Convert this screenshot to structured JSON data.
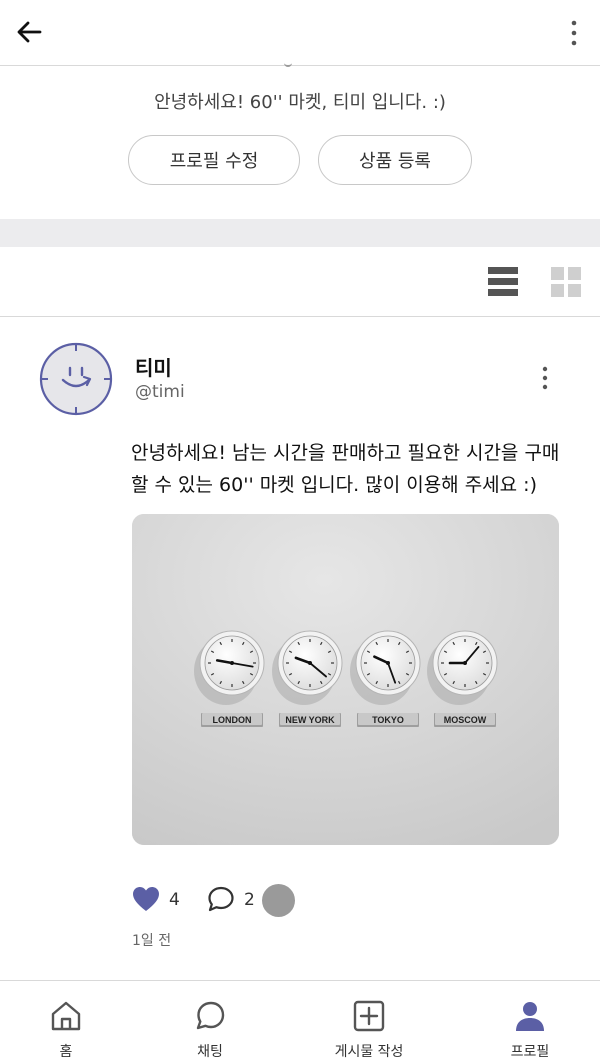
{
  "header": {
    "back_icon": "arrow-left-icon",
    "more_icon": "vertical-ellipsis-icon"
  },
  "profile": {
    "greeting": "안녕하세요! 60'' 마켓, 티미 입니다. :)",
    "edit_profile_label": "프로필 수정",
    "add_product_label": "상품 등록"
  },
  "view_toggle": {
    "list_icon": "list-view-icon",
    "grid_icon": "grid-view-icon",
    "active": "list"
  },
  "post": {
    "author_name": "티미",
    "author_handle": "@timi",
    "text": "안녕하세요! 남는 시간을 판매하고 필요한 시간을 구매할 수 있는 60'' 마켓 입니다. 많이 이용해 주세요 :)",
    "image": {
      "clocks": [
        "LONDON",
        "NEW YORK",
        "TOKYO",
        "MOSCOW"
      ]
    },
    "likes": "4",
    "comments": "2",
    "timestamp": "1일 전"
  },
  "tabbar": {
    "items": [
      {
        "label": "홈",
        "icon": "home-icon"
      },
      {
        "label": "채팅",
        "icon": "chat-icon"
      },
      {
        "label": "게시물 작성",
        "icon": "add-post-icon"
      },
      {
        "label": "프로필",
        "icon": "profile-icon",
        "active": true
      }
    ]
  },
  "colors": {
    "accent": "#5b5fa5",
    "divider": "#d9d9d9",
    "band": "#ececee",
    "inactive_icon": "#555555"
  }
}
